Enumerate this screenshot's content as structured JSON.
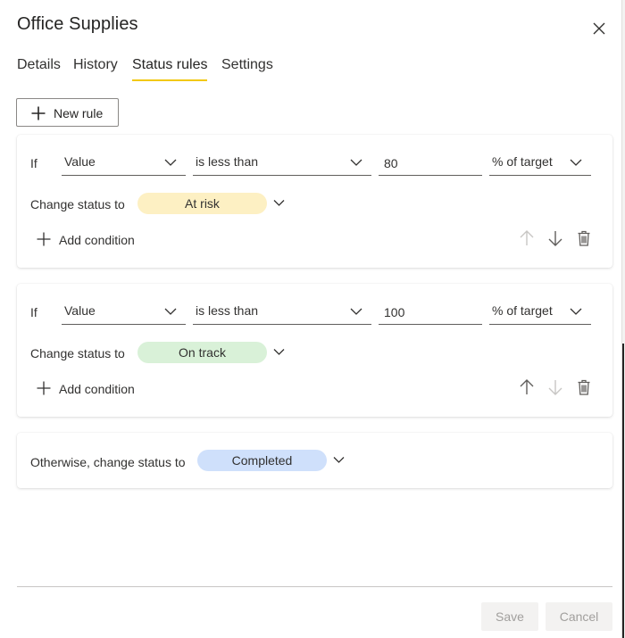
{
  "dialog": {
    "title": "Office Supplies"
  },
  "tabs": [
    {
      "label": "Details",
      "active": false
    },
    {
      "label": "History",
      "active": false
    },
    {
      "label": "Status rules",
      "active": true
    },
    {
      "label": "Settings",
      "active": false
    }
  ],
  "toolbar": {
    "new_rule_label": "New rule"
  },
  "rules": [
    {
      "if_label": "If",
      "field": "Value",
      "operator": "is less than",
      "value": "80",
      "unit": "% of target",
      "change_label": "Change status to",
      "status": "At risk",
      "status_color": "#fdf0c3",
      "add_condition_label": "Add condition",
      "move_up_enabled": false,
      "move_down_enabled": true
    },
    {
      "if_label": "If",
      "field": "Value",
      "operator": "is less than",
      "value": "100",
      "unit": "% of target",
      "change_label": "Change status to",
      "status": "On track",
      "status_color": "#d9f1d8",
      "add_condition_label": "Add condition",
      "move_up_enabled": true,
      "move_down_enabled": false
    }
  ],
  "otherwise": {
    "label": "Otherwise, change status to",
    "status": "Completed",
    "status_color": "#cfe0fb"
  },
  "footer": {
    "save_label": "Save",
    "cancel_label": "Cancel",
    "save_enabled": false,
    "cancel_enabled": false
  },
  "colors": {
    "accent_underline": "#f2c811",
    "icon_enabled": "#605e5c",
    "icon_disabled": "#c8c6c4"
  },
  "icons": {
    "close": "close-icon",
    "add": "plus-icon",
    "dropdown": "chevron-down-icon",
    "move_up": "arrow-up-icon",
    "move_down": "arrow-down-icon",
    "delete": "trash-icon"
  }
}
